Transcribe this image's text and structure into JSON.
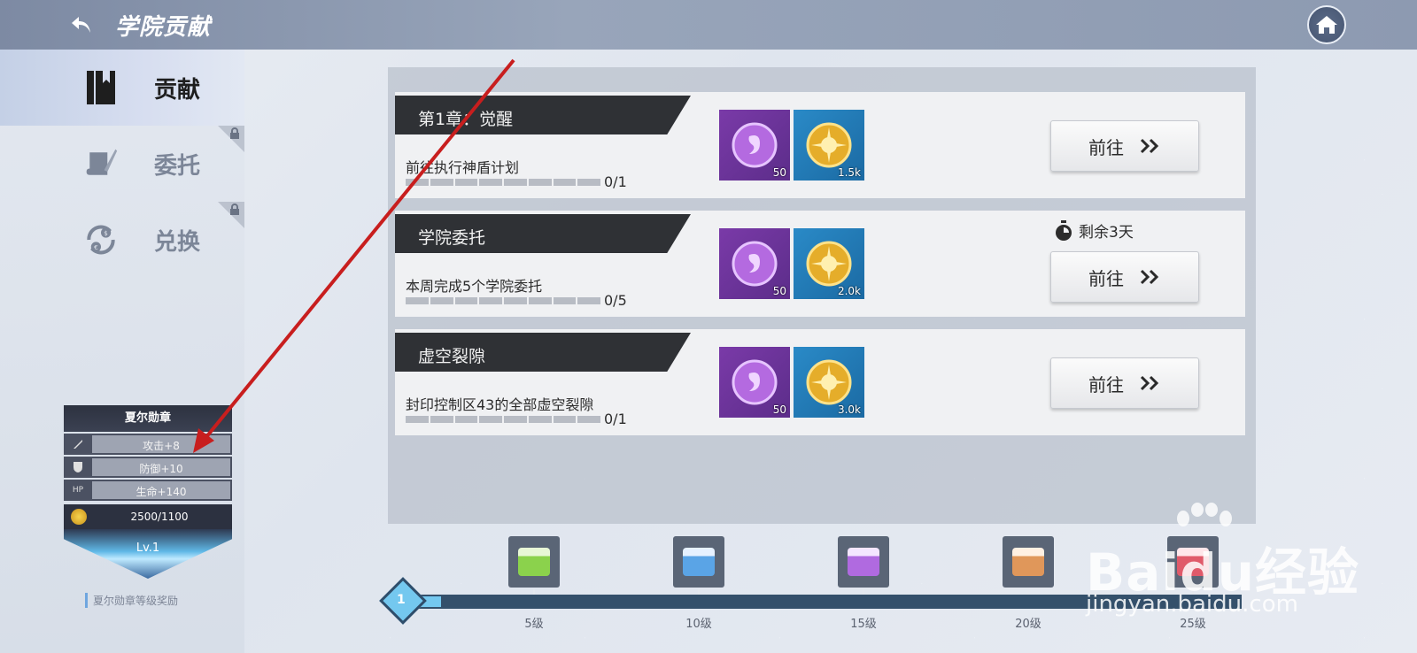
{
  "header": {
    "title": "学院贡献",
    "back_icon": "back-arrow-icon",
    "home_icon": "home-icon"
  },
  "sidebar": {
    "items": [
      {
        "label": "贡献",
        "icon": "book-icon",
        "active": true,
        "locked": false
      },
      {
        "label": "委托",
        "icon": "scroll-quill-icon",
        "active": false,
        "locked": true
      },
      {
        "label": "兑换",
        "icon": "exchange-icon",
        "active": false,
        "locked": true
      }
    ]
  },
  "medal": {
    "title": "夏尔勋章",
    "stats": [
      {
        "icon": "sword-icon",
        "text": "攻击+8"
      },
      {
        "icon": "shield-icon",
        "text": "防御+10"
      },
      {
        "icon": "HP",
        "text": "生命+140"
      }
    ],
    "exp": "2500/1100",
    "level": "Lv.1",
    "caption": "夏尔勋章等级奖励"
  },
  "tasks": [
    {
      "title": "第1章：觉醒",
      "desc": "前往执行神盾计划",
      "count": "0/1",
      "progress": 0,
      "rewards": [
        {
          "type": "purple-crystal",
          "amount": "50"
        },
        {
          "type": "gold-coin",
          "amount": "1.5k"
        }
      ],
      "button": "前往",
      "timer": ""
    },
    {
      "title": "学院委托",
      "desc": "本周完成5个学院委托",
      "count": "0/5",
      "progress": 0,
      "rewards": [
        {
          "type": "purple-crystal",
          "amount": "50"
        },
        {
          "type": "gold-coin",
          "amount": "2.0k"
        }
      ],
      "button": "前往",
      "timer": "剩余3天"
    },
    {
      "title": "虚空裂隙",
      "desc": "封印控制区43的全部虚空裂隙",
      "count": "0/1",
      "progress": 0,
      "rewards": [
        {
          "type": "purple-crystal",
          "amount": "50"
        },
        {
          "type": "gold-coin",
          "amount": "3.0k"
        }
      ],
      "button": "前往",
      "timer": ""
    }
  ],
  "level_track": {
    "current_level": "1",
    "chests": [
      {
        "label": "5级",
        "color": "#8bd24c"
      },
      {
        "label": "10级",
        "color": "#5aa4e6"
      },
      {
        "label": "15级",
        "color": "#b06ae0"
      },
      {
        "label": "20级",
        "color": "#e0975a"
      },
      {
        "label": "25级",
        "color": "#e05a6a"
      }
    ]
  },
  "watermark": {
    "main": "Baidu经验",
    "sub": "jingyan.baidu.com"
  },
  "colors": {
    "header_bg": "#8d9ab1",
    "title_bar": "#2f3135",
    "reward_purple": "#6a33a0",
    "reward_blue": "#2480bd",
    "track": "#34506b",
    "track_fill": "#74c8ef",
    "annotation": "#c81e1e"
  }
}
